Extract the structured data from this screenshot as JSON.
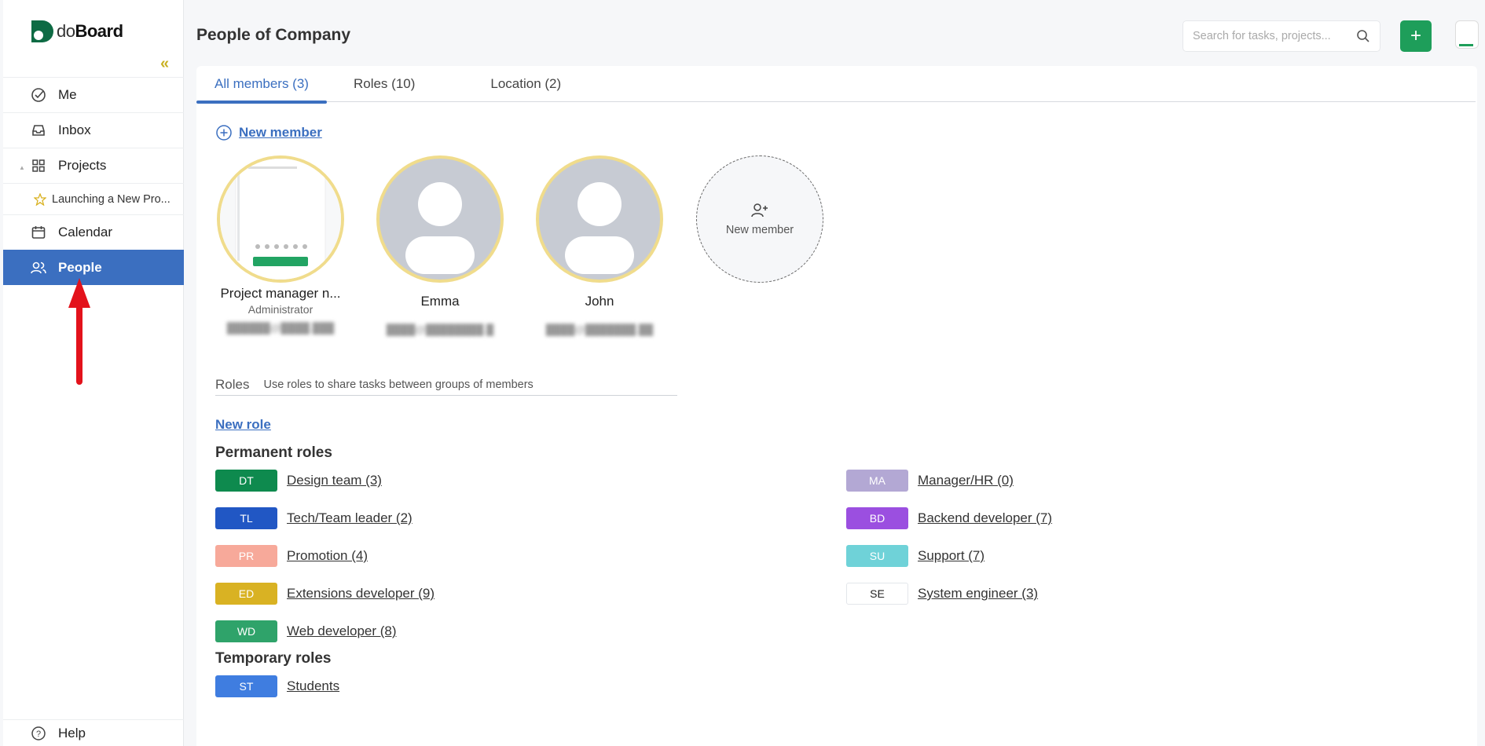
{
  "app": {
    "logo_do": "do",
    "logo_board": "Board"
  },
  "sidebar": {
    "items": [
      {
        "label": "Me",
        "icon": "check-circle-icon"
      },
      {
        "label": "Inbox",
        "icon": "inbox-icon"
      },
      {
        "label": "Projects",
        "icon": "grid-icon"
      },
      {
        "label": "Launching a New Pro...",
        "icon": "star-icon"
      },
      {
        "label": "Calendar",
        "icon": "calendar-icon"
      },
      {
        "label": "People",
        "icon": "people-icon",
        "active": true
      }
    ],
    "help": "Help"
  },
  "header": {
    "title": "People of Company",
    "search_placeholder": "Search for tasks, projects...",
    "add_label": "+"
  },
  "tabs": [
    {
      "label": "All members (3)",
      "active": true
    },
    {
      "label": "Roles (10)"
    },
    {
      "label": "Location (2)"
    }
  ],
  "members_section": {
    "new_member_link": "New member",
    "new_member_card": "New member",
    "members": [
      {
        "name": "Project manager n...",
        "role": "Administrator",
        "email": "██████@████.███"
      },
      {
        "name": "Emma",
        "email": "████@████████.█"
      },
      {
        "name": "John",
        "email": "████@███████.██"
      }
    ]
  },
  "roles_section": {
    "title": "Roles",
    "description": "Use roles to share tasks between groups of members",
    "new_role": "New role",
    "permanent_title": "Permanent roles",
    "temporary_title": "Temporary roles",
    "permanent_left": [
      {
        "code": "DT",
        "name": "Design team (3)",
        "color": "#0e8a4e"
      },
      {
        "code": "TL",
        "name": "Tech/Team leader (2)",
        "color": "#2157c4"
      },
      {
        "code": "PR",
        "name": "Promotion (4)",
        "color": "#f7a99a"
      },
      {
        "code": "ED",
        "name": "Extensions developer (9)",
        "color": "#d9b223"
      },
      {
        "code": "WD",
        "name": "Web developer (8)",
        "color": "#2fa36a"
      }
    ],
    "permanent_right": [
      {
        "code": "MA",
        "name": "Manager/HR (0)",
        "color": "#b3a8d4"
      },
      {
        "code": "BD",
        "name": "Backend developer (7)",
        "color": "#9b4fe0"
      },
      {
        "code": "SU",
        "name": "Support (7)",
        "color": "#6fd2d8"
      },
      {
        "code": "SE",
        "name": "System engineer (3)",
        "color": "#ffffff"
      }
    ],
    "temporary": [
      {
        "code": "ST",
        "name": "Students",
        "color": "#3f7de0"
      }
    ]
  }
}
